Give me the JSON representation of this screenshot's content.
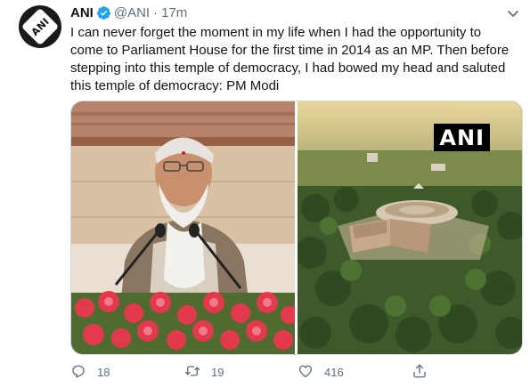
{
  "tweet": {
    "author_name": "ANI",
    "handle": "@ANI",
    "separator": "·",
    "time": "17m",
    "text": "I can never forget the moment in my life when I had the opportunity to come to Parliament House for the first time in 2014 as an MP. Then before stepping into this temple of democracy, I had bowed my head and saluted this temple of democracy: PM Modi",
    "avatar_logo_text": "ANI",
    "media": {
      "left_image": "pm-modi-speaking-at-podium",
      "right_image": "parliament-aerial-render",
      "watermark": "ANI"
    },
    "actions": {
      "reply_count": "18",
      "retweet_count": "19",
      "like_count": "416"
    }
  },
  "colors": {
    "text_primary": "#0f1419",
    "text_secondary": "#5b7083",
    "verified_blue": "#1da1f2",
    "border": "#cfd9de"
  },
  "icons": [
    "verified-badge-icon",
    "caret-down-icon",
    "reply-icon",
    "retweet-icon",
    "like-icon",
    "share-icon"
  ]
}
